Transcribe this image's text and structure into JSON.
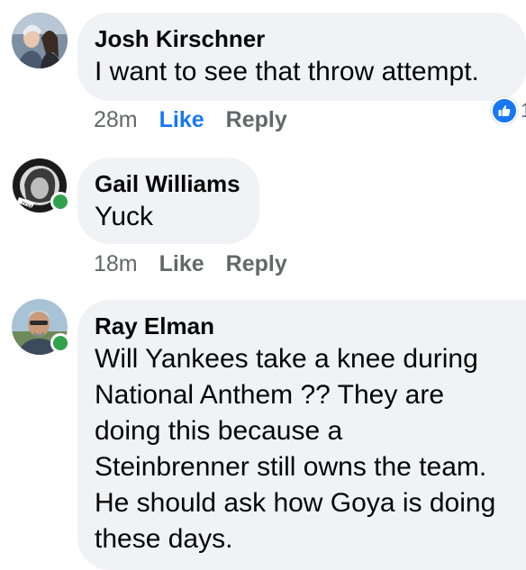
{
  "comments": [
    {
      "author": "Josh Kirschner",
      "text": "I want to see that throw attempt.",
      "time": "28m",
      "like_label": "Like",
      "reply_label": "Reply",
      "liked": true,
      "reaction_icon": "thumbs-up-icon",
      "reaction_count": "1",
      "online": false
    },
    {
      "author": "Gail Williams",
      "text": "Yuck",
      "time": "18m",
      "like_label": "Like",
      "reply_label": "Reply",
      "liked": false,
      "online": true
    },
    {
      "author": "Ray Elman",
      "text": "Will Yankees take a knee during\nNational Anthem ??  They are\ndoing this because a\nSteinbrenner still owns the team.\nHe should ask how Goya is doing\nthese days.",
      "online": true
    }
  ],
  "colors": {
    "bubble": "#f0f2f5",
    "link_blue": "#1877f2",
    "meta_gray": "#65676b",
    "online_green": "#31a24c"
  }
}
